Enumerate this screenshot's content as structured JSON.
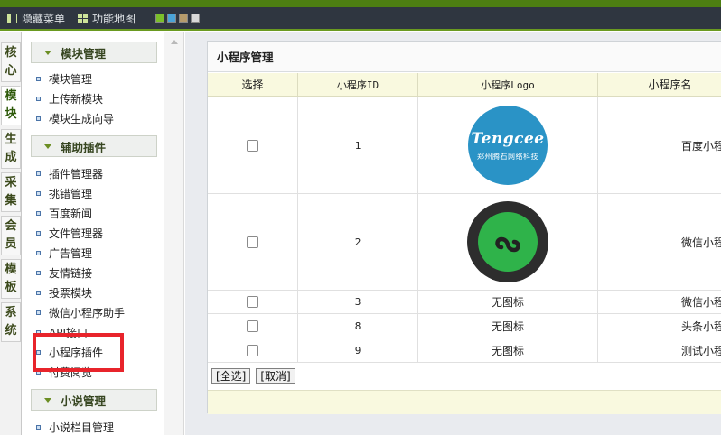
{
  "topbar": {
    "hide_menu": "隐藏菜单",
    "site_map": "功能地图"
  },
  "theme_swatches": [
    "#7bbf2a",
    "#4aa3d8",
    "#b59b6b",
    "#d8d8d8"
  ],
  "vtabs": [
    {
      "label": "核心",
      "active": false
    },
    {
      "label": "模块",
      "active": true
    },
    {
      "label": "生成",
      "active": false
    },
    {
      "label": "采集",
      "active": false
    },
    {
      "label": "会员",
      "active": false
    },
    {
      "label": "模板",
      "active": false
    },
    {
      "label": "系统",
      "active": false
    }
  ],
  "sidebar": {
    "sections": [
      {
        "title": "模块管理",
        "items": [
          "模块管理",
          "上传新模块",
          "模块生成向导"
        ]
      },
      {
        "title": "辅助插件",
        "items": [
          "插件管理器",
          "挑错管理",
          "百度新闻",
          "文件管理器",
          "广告管理",
          "友情链接",
          "投票模块",
          "微信小程序助手",
          "API接口",
          "小程序插件",
          "付费阅览"
        ]
      },
      {
        "title": "小说管理",
        "items": [
          "小说栏目管理"
        ]
      }
    ]
  },
  "panel": {
    "title": "小程序管理",
    "columns": [
      "选择",
      "小程序ID",
      "小程序Logo",
      "小程序名"
    ],
    "rows": [
      {
        "id": "1",
        "logo": "tengcee",
        "name": "百度小程"
      },
      {
        "id": "2",
        "logo": "wechat",
        "name": "微信小程"
      },
      {
        "id": "3",
        "logo": "无图标",
        "name": "微信小程"
      },
      {
        "id": "8",
        "logo": "无图标",
        "name": "头条小程"
      },
      {
        "id": "9",
        "logo": "无图标",
        "name": "测试小程"
      }
    ],
    "logo_tengcee": {
      "name": "Tengcee",
      "sub": "郑州腾石网络科技"
    },
    "select_all": "[全选]",
    "cancel": "[取消]"
  }
}
